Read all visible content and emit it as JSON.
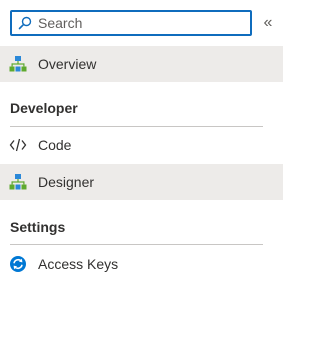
{
  "search": {
    "placeholder": "Search",
    "icon": "search-icon"
  },
  "collapse": {
    "glyph": "«",
    "icon": "double-chevron-left-icon"
  },
  "top_items": [
    {
      "label": "Overview",
      "icon": "overview-icon",
      "selected": true
    }
  ],
  "sections": [
    {
      "header": "Developer",
      "items": [
        {
          "label": "Code",
          "icon": "code-icon",
          "selected": false
        },
        {
          "label": "Designer",
          "icon": "designer-icon",
          "selected": true
        }
      ]
    },
    {
      "header": "Settings",
      "items": [
        {
          "label": "Access Keys",
          "icon": "access-keys-icon",
          "selected": false
        }
      ]
    }
  ],
  "colors": {
    "accent": "#0f6cbd",
    "selected_bg": "#edebe9",
    "divider": "#c8c6c4",
    "text": "#323130",
    "icon_green": "#5ea92f",
    "icon_blue": "#2b88d8",
    "icon_key_blue": "#0078d4"
  }
}
